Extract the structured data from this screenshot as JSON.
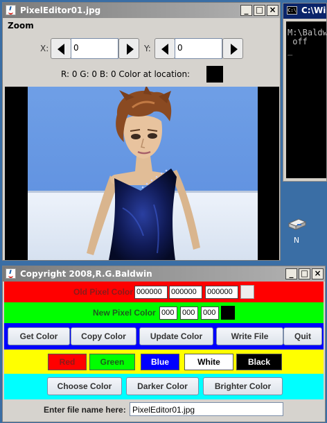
{
  "console": {
    "title": "C:\\Win",
    "icon_text": "C:\\",
    "lines": "M:\\Baldw\n off\n_"
  },
  "desktop": {
    "icon_label": "N"
  },
  "editor": {
    "title": "PixelEditor01.jpg",
    "menu": [
      "Zoom"
    ],
    "x_label": "X:",
    "x_value": "0",
    "y_label": "Y:",
    "y_value": "0",
    "rgb_text": "R: 0 G: 0 B: 0 Color at location:",
    "swatch_color": "#000000"
  },
  "controls": {
    "title": "Copyright 2008,R.G.Baldwin",
    "old_label": "Old Pixel Color",
    "old_values": [
      "000000",
      "000000",
      "000000"
    ],
    "new_label": "New Pixel Color",
    "new_values": [
      "000",
      "000",
      "000"
    ],
    "buttons": [
      "Get Color",
      "Copy Color",
      "Update Color",
      "Write File",
      "Quit"
    ],
    "colors": [
      "Red",
      "Green",
      "Blue",
      "White",
      "Black"
    ],
    "adjust_buttons": [
      "Choose Color",
      "Darker Color",
      "Brighter Color"
    ],
    "file_label": "Enter file name here:",
    "file_value": "PixelEditor01.jpg"
  },
  "window_buttons": {
    "minimize": "_",
    "maximize": "□",
    "close": "×"
  },
  "theme": {
    "old_row": "#ff0000",
    "new_row": "#00ff00",
    "button_row": "#0000ff",
    "color_row": "#ffff00",
    "adjust_row": "#00ffff"
  }
}
